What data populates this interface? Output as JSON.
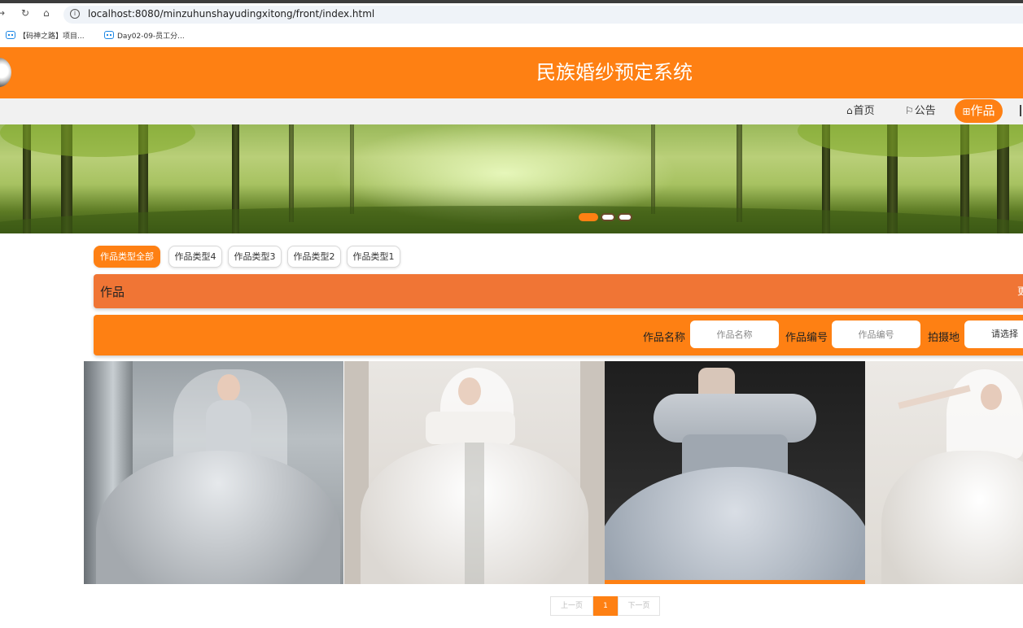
{
  "browser": {
    "nav_back": "→",
    "nav_reload": "↻",
    "nav_home": "⌂",
    "url": "localhost:8080/minzuhunshayudingxitong/front/index.html",
    "bookmarks": [
      {
        "label": "【码神之路】项目..."
      },
      {
        "label": "Day02-09-员工分..."
      }
    ]
  },
  "site": {
    "title": "民族婚纱预定系统"
  },
  "menu": {
    "items": [
      {
        "icon": "⌂",
        "label": "首页"
      },
      {
        "icon": "⚐",
        "label": "公告"
      },
      {
        "icon": "⊞",
        "label": "作品",
        "active": true
      }
    ]
  },
  "banner": {
    "slide_count": 3,
    "active_slide": 1
  },
  "categories": [
    "作品类型全部",
    "作品类型4",
    "作品类型3",
    "作品类型2",
    "作品类型1"
  ],
  "active_category": 0,
  "section": {
    "title": "作品",
    "more_label": "更"
  },
  "search": {
    "name_label": "作品名称",
    "name_placeholder": "作品名称",
    "code_label": "作品编号",
    "code_placeholder": "作品编号",
    "location_label": "拍摄地",
    "location_value": "请选择"
  },
  "products": [
    {
      "icon": "wedding-dress-photo-1"
    },
    {
      "icon": "wedding-dress-photo-2"
    },
    {
      "icon": "wedding-dress-photo-3",
      "hovered": true
    },
    {
      "icon": "wedding-dress-photo-4"
    }
  ],
  "pagination": {
    "prev": "上一页",
    "current": "1",
    "next": "下一页"
  },
  "colors": {
    "brand_orange": "#fe8013",
    "section_orange": "#f07535",
    "menu_bg": "#f1f1f1"
  }
}
